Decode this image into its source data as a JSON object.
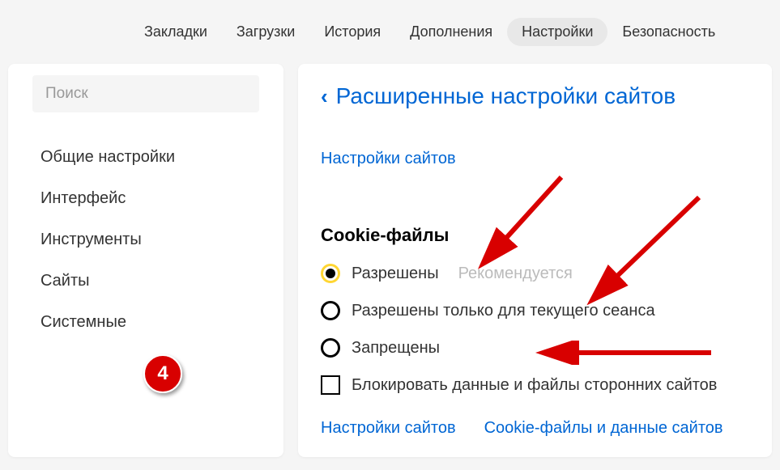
{
  "top_nav": {
    "items": [
      "Закладки",
      "Загрузки",
      "История",
      "Дополнения",
      "Настройки",
      "Безопасность"
    ],
    "active_index": 4
  },
  "sidebar": {
    "search_placeholder": "Поиск",
    "items": [
      "Общие настройки",
      "Интерфейс",
      "Инструменты",
      "Сайты",
      "Системные"
    ]
  },
  "main": {
    "title": "Расширенные настройки сайтов",
    "site_settings_link": "Настройки сайтов",
    "cookie_section": {
      "heading": "Cookie-файлы",
      "options": [
        {
          "label": "Разрешены",
          "recommended": "Рекомендуется",
          "selected": true
        },
        {
          "label": "Разрешены только для текущего сеанса",
          "selected": false
        },
        {
          "label": "Запрещены",
          "selected": false
        }
      ],
      "checkbox_label": "Блокировать данные и файлы сторонних сайтов"
    },
    "bottom_links": [
      "Настройки сайтов",
      "Cookie-файлы и данные сайтов"
    ]
  },
  "annotation_badge": "4"
}
